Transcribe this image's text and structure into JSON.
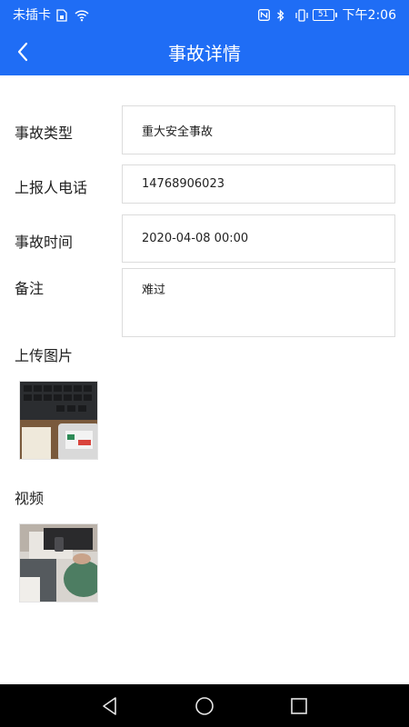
{
  "status_bar": {
    "carrier": "未插卡",
    "time": "下午2:06",
    "battery": "51",
    "icons": [
      "sim-icon",
      "wifi-icon",
      "nfc-icon",
      "bluetooth-icon",
      "vibrate-icon",
      "battery-icon"
    ]
  },
  "header": {
    "title": "事故详情",
    "back_icon": "back-arrow-icon"
  },
  "form": {
    "type_label": "事故类型",
    "type_value": "重大安全事故",
    "phone_label": "上报人电话",
    "phone_value": "14768906023",
    "time_label": "事故时间",
    "time_value": "2020-04-08 00:00",
    "note_label": "备注",
    "note_value": "难过"
  },
  "media": {
    "image_label": "上传图片",
    "video_label": "视频"
  },
  "nav_bar": {
    "icons": [
      "back-triangle-icon",
      "home-circle-icon",
      "recent-square-icon"
    ]
  },
  "colors": {
    "header_bg": "#1f6df5",
    "navbar_bg": "#000000",
    "field_border": "#dcdcdc"
  }
}
